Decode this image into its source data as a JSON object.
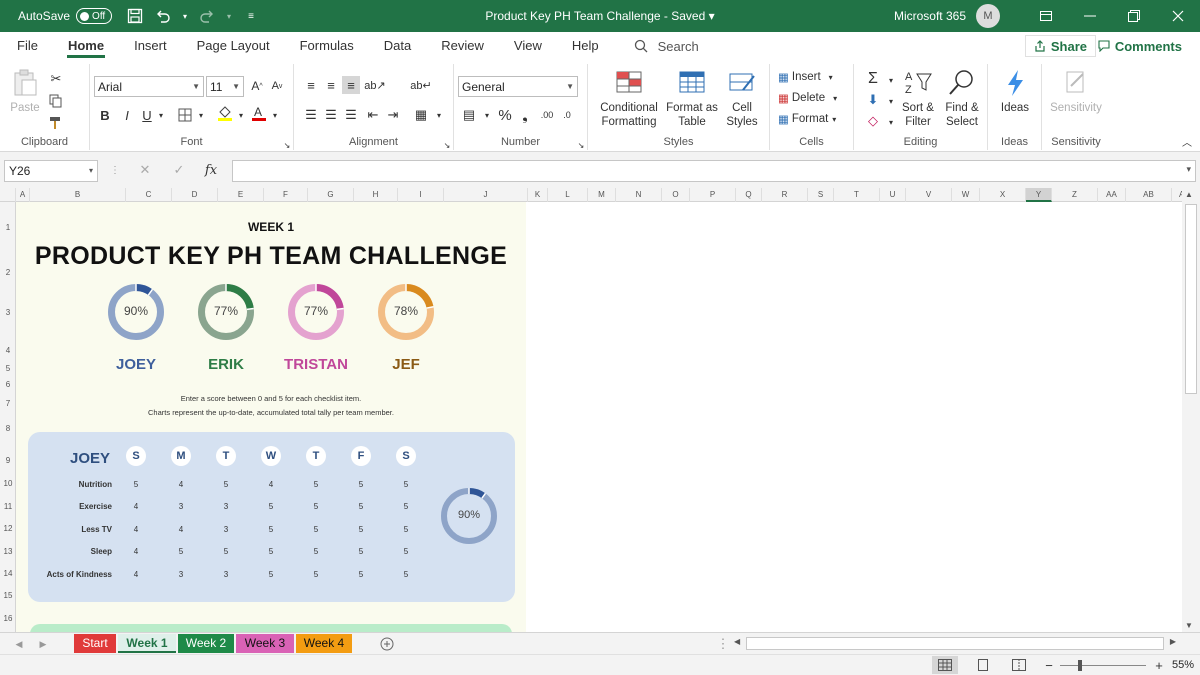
{
  "titlebar": {
    "autosave_label": "AutoSave",
    "autosave_state": "Off",
    "document_title": "Product Key PH Team Challenge",
    "saved_state": "Saved",
    "account_label": "Microsoft 365",
    "avatar_initial": "M"
  },
  "ribbon_tabs": [
    "File",
    "Home",
    "Insert",
    "Page Layout",
    "Formulas",
    "Data",
    "Review",
    "View",
    "Help"
  ],
  "active_tab": "Home",
  "search_label": "Search",
  "share_label": "Share",
  "comments_label": "Comments",
  "ribbon": {
    "clipboard": {
      "paste_label": "Paste",
      "group_label": "Clipboard"
    },
    "font": {
      "font_name": "Arial",
      "font_size": "11",
      "group_label": "Font"
    },
    "alignment": {
      "group_label": "Alignment"
    },
    "number": {
      "format": "General",
      "group_label": "Number"
    },
    "styles": {
      "conditional_line1": "Conditional",
      "conditional_line2": "Formatting",
      "format_table_line1": "Format as",
      "format_table_line2": "Table",
      "cell_styles_line1": "Cell",
      "cell_styles_line2": "Styles",
      "group_label": "Styles"
    },
    "cells": {
      "insert_label": "Insert",
      "delete_label": "Delete",
      "format_label": "Format",
      "group_label": "Cells"
    },
    "editing": {
      "sort_line1": "Sort &",
      "sort_line2": "Filter",
      "find_line1": "Find &",
      "find_line2": "Select",
      "group_label": "Editing"
    },
    "ideas": {
      "label": "Ideas",
      "group_label": "Ideas"
    },
    "sensitivity": {
      "label": "Sensitivity",
      "group_label": "Sensitivity"
    }
  },
  "name_box": "Y26",
  "formula_fx": "fx",
  "columns": [
    "A",
    "B",
    "C",
    "D",
    "E",
    "F",
    "G",
    "H",
    "I",
    "J",
    "K",
    "L",
    "M",
    "N",
    "O",
    "P",
    "Q",
    "R",
    "S",
    "T",
    "U",
    "V",
    "W",
    "X",
    "Y",
    "Z",
    "AA",
    "AB",
    "AC"
  ],
  "rows": [
    "1",
    "2",
    "3",
    "4",
    "5",
    "6",
    "7",
    "8",
    "9",
    "10",
    "11",
    "12",
    "13",
    "14",
    "15",
    "16"
  ],
  "dashboard": {
    "week_label": "WEEK 1",
    "title": "PRODUCT KEY PH TEAM CHALLENGE",
    "members": [
      {
        "name": "JOEY",
        "pct_label": "90%",
        "progress": 0.9,
        "color": "#8ea4c8",
        "accent": "#2f5597",
        "name_color": "#3e5f9c"
      },
      {
        "name": "ERIK",
        "pct_label": "77%",
        "progress": 0.77,
        "color": "#8aa58f",
        "accent": "#2e7d46",
        "name_color": "#2e7d46"
      },
      {
        "name": "TRISTAN",
        "pct_label": "77%",
        "progress": 0.77,
        "color": "#e4a2cf",
        "accent": "#c0479a",
        "name_color": "#c0479a"
      },
      {
        "name": "JEF",
        "pct_label": "78%",
        "progress": 0.78,
        "color": "#f2bd85",
        "accent": "#d98a1e",
        "name_color": "#8a5a14"
      }
    ],
    "instruction_line1": "Enter a score between 0 and 5 for each checklist item.",
    "instruction_line2": "Charts represent the up-to-date, accumulated total tally per team member.",
    "joey_panel": {
      "name": "JOEY",
      "days": [
        "S",
        "M",
        "T",
        "W",
        "T",
        "F",
        "S"
      ],
      "categories": [
        "Nutrition",
        "Exercise",
        "Less TV",
        "Sleep",
        "Acts of Kindness"
      ],
      "scores": [
        [
          "5",
          "4",
          "5",
          "4",
          "5",
          "5",
          "5"
        ],
        [
          "4",
          "3",
          "3",
          "5",
          "5",
          "5",
          "5"
        ],
        [
          "4",
          "4",
          "3",
          "5",
          "5",
          "5",
          "5"
        ],
        [
          "4",
          "5",
          "5",
          "5",
          "5",
          "5",
          "5"
        ],
        [
          "4",
          "3",
          "3",
          "5",
          "5",
          "5",
          "5"
        ]
      ],
      "pct_label": "90%",
      "progress": 0.9
    }
  },
  "sheet_tabs": [
    {
      "label": "Start",
      "bg": "#e03a3a",
      "fg": "#ffffff"
    },
    {
      "label": "Week 1",
      "bg": "#dff0ea",
      "fg": "#217346"
    },
    {
      "label": "Week 2",
      "bg": "#1e8a48",
      "fg": "#ffffff"
    },
    {
      "label": "Week 3",
      "bg": "#d962b5",
      "fg": "#111111"
    },
    {
      "label": "Week 4",
      "bg": "#f39c12",
      "fg": "#111111"
    }
  ],
  "zoom": "55%"
}
